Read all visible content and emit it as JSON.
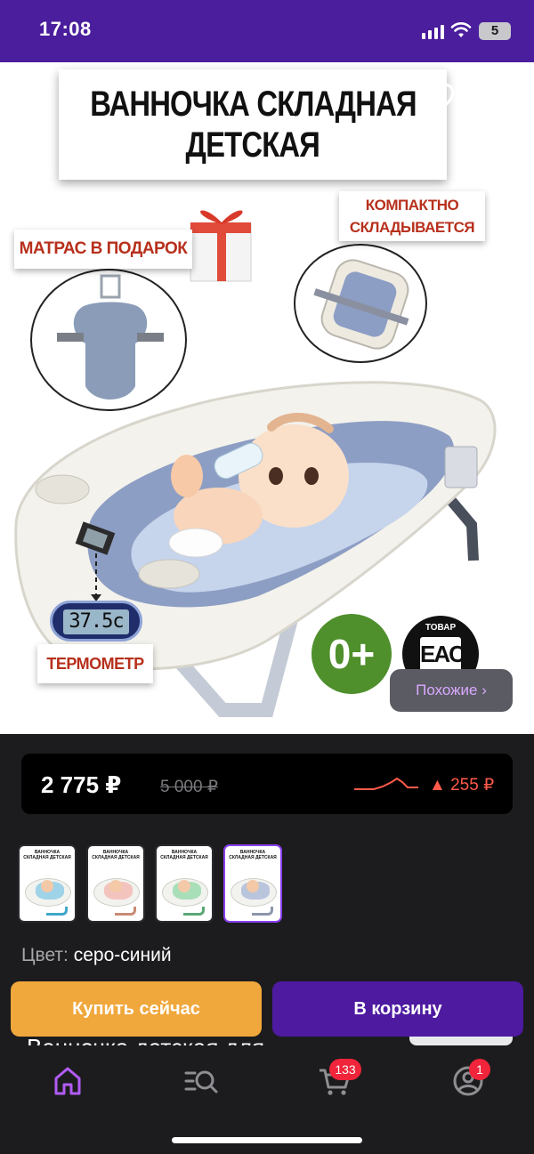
{
  "status_bar": {
    "time": "17:08",
    "battery": "5"
  },
  "product_image": {
    "title_line1": "ВАННОЧКА СКЛАДНАЯ",
    "title_line2": "ДЕТСКАЯ",
    "gift_label": "МАТРАС В ПОДАРОК",
    "compact_label_line1": "КОМПАКТНО",
    "compact_label_line2": "СКЛАДЫВАЕТСЯ",
    "thermometer_display": "37.5c",
    "thermometer_label": "ТЕРМОМЕТР",
    "age_badge": "0+",
    "eac_top": "ТОВАР",
    "eac_mark": "EAC"
  },
  "similar_button": "Похожие ›",
  "price": {
    "current": "2 775 ₽",
    "old": "5 000 ₽",
    "change": "▲ 255 ₽",
    "trend_color": "#ff5a4a"
  },
  "thumbnails": [
    {
      "title": "ВАННОЧКА СКЛАДНАЯ ДЕТСКАЯ",
      "color": "#9fd3e8",
      "leg": "#3fa7c8",
      "active": false
    },
    {
      "title": "ВАННОЧКА СКЛАДНАЯ ДЕТСКАЯ",
      "color": "#f3c3bd",
      "leg": "#c98a74",
      "active": false
    },
    {
      "title": "ВАННОЧКА СКЛАДНАЯ ДЕТСКАЯ",
      "color": "#a9dfb8",
      "leg": "#5aa874",
      "active": false
    },
    {
      "title": "ВАННОЧКА СКЛАДНАЯ ДЕТСКАЯ",
      "color": "#b9c5dc",
      "leg": "#8b96ac",
      "active": true
    }
  ],
  "color_option": {
    "label": "Цвет:",
    "value": "серо-синий"
  },
  "buttons": {
    "buy_now": "Купить сейчас",
    "to_cart": "В корзину"
  },
  "product_title_peek": "Ванночка детская для",
  "tab_bar": {
    "cart_badge": "133",
    "profile_badge": "1"
  },
  "colors": {
    "brand_purple": "#4a1e9c",
    "buy_orange": "#f0a73c",
    "cart_purple": "#4d1aa0",
    "accent_lilac": "#d9a8ff"
  }
}
